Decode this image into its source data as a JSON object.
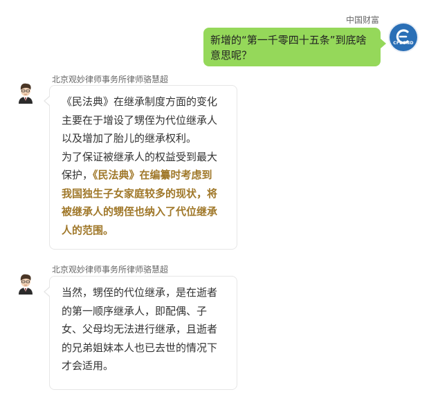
{
  "user_message": {
    "sender": "中国财富",
    "logo_text": "CFBOND",
    "lines": [
      "新增的“第一千零四十五条”到底啥",
      "意思呢？"
    ]
  },
  "bot_messages": [
    {
      "sender": "北京观妙律师事务所律师骆慧超",
      "lines": [
        "《民法典》在继承制度方面的变化",
        "主要在于增设了甥侄为代位继承人",
        "以及增加了胎儿的继承权利。",
        "为了保证被继承人的权益受到最大",
        "保护，",
        "我国独生子女家庭较多的现状，将",
        "被继承人的甥侄也纳入了代位继承",
        "人的范围。"
      ],
      "highlight_inline": "《民法典》在编纂时考虑到"
    },
    {
      "sender": "北京观妙律师事务所律师骆慧超",
      "lines": [
        "当然，甥侄的代位继承，是在逝者",
        "的第一顺序继承人，即配偶、子",
        "女、父母均无法进行继承，且逝者",
        "的兄弟姐妹本人也已去世的情况下",
        "才会适用。"
      ]
    }
  ],
  "colors": {
    "user_bubble": "#95d85a",
    "highlight_text": "#a0782a",
    "logo_blue": "#2a6fb6"
  }
}
